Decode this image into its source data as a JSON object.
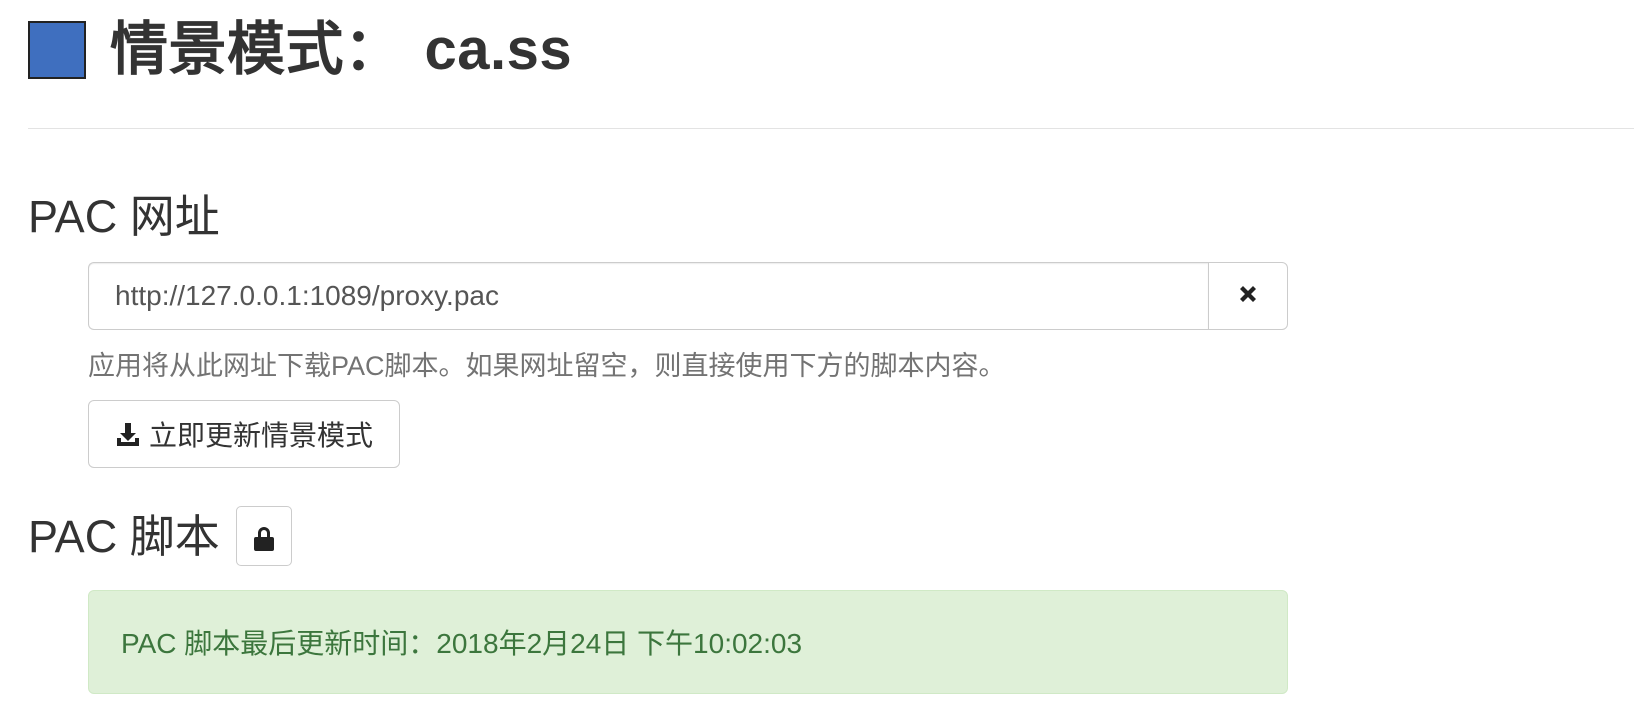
{
  "header": {
    "profile_color": "#3f6fbf",
    "title_prefix": "情景模式：",
    "profile_name": "ca.ss"
  },
  "pac_url_section": {
    "heading": "PAC 网址",
    "url_value": "http://127.0.0.1:1089/proxy.pac",
    "clear_icon": "times-icon",
    "help_text": "应用将从此网址下载PAC脚本。如果网址留空，则直接使用下方的脚本内容。",
    "update_button_label": "立即更新情景模式",
    "update_icon": "download-icon"
  },
  "pac_script_section": {
    "heading": "PAC 脚本",
    "lock_icon": "lock-icon",
    "last_update_text": "PAC 脚本最后更新时间：2018年2月24日 下午10:02:03"
  },
  "colors": {
    "success_bg": "#dff0d8",
    "success_text": "#3c763d"
  }
}
